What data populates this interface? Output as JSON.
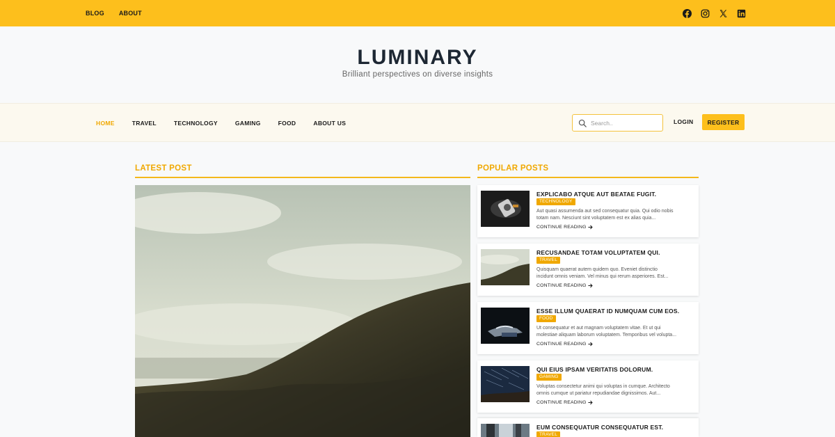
{
  "topbar": {
    "links": [
      "BLOG",
      "ABOUT"
    ],
    "social_icons": [
      "facebook-icon",
      "instagram-icon",
      "x-icon",
      "linkedin-icon"
    ],
    "background": "#fdbf1c"
  },
  "brand": {
    "title": "LUMINARY",
    "tagline": "Brilliant perspectives on diverse insights"
  },
  "nav": {
    "items": [
      {
        "label": "HOME",
        "active": true
      },
      {
        "label": "TRAVEL",
        "active": false
      },
      {
        "label": "TECHNOLOGY",
        "active": false
      },
      {
        "label": "GAMING",
        "active": false
      },
      {
        "label": "FOOD",
        "active": false
      },
      {
        "label": "ABOUT US",
        "active": false
      }
    ],
    "search_placeholder": "Search..",
    "login_label": "LOGIN",
    "register_label": "REGISTER"
  },
  "latest": {
    "heading": "LATEST POST"
  },
  "popular": {
    "heading": "POPULAR POSTS",
    "posts": [
      {
        "title": "EXPLICABO ATQUE AUT BEATAE FUGIT.",
        "category": "TECHNOLOGY",
        "excerpt_line1": "Aut quasi assumenda aut sed consequatur quia. Qui odio nobis",
        "excerpt_line2": "totam nam. Nesciunt sint voluptatem est ex alias quia...",
        "more": "CONTINUE READING"
      },
      {
        "title": "RECUSANDAE TOTAM VOLUPTATEM QUI.",
        "category": "TRAVEL",
        "excerpt_line1": "Quisquam quaerat autem quidem quo. Eveniet distinctio",
        "excerpt_line2": "incidunt omnis veniam. Vel minus qui rerum asperiores. Est...",
        "more": "CONTINUE READING"
      },
      {
        "title": "ESSE ILLUM QUAERAT ID NUMQUAM CUM EOS.",
        "category": "FOOD",
        "excerpt_line1": "Ut consequatur et aut magnam voluptatem vitae. Et ut qui",
        "excerpt_line2": "molestiae aliquam laborum voluptatem. Temporibus vel volupta...",
        "more": "CONTINUE READING"
      },
      {
        "title": "QUI EIUS IPSAM VERITATIS DOLORUM.",
        "category": "GAMING",
        "excerpt_line1": "Voluptas consectetur animi qui voluptas in cumque. Architecto",
        "excerpt_line2": "omnis cumque ut pariatur repudiandae dignissimos. Aut...",
        "more": "CONTINUE READING"
      },
      {
        "title": "EUM CONSEQUATUR CONSEQUATUR EST.",
        "category": "TRAVEL",
        "excerpt_line1": "",
        "excerpt_line2": "",
        "more": ""
      }
    ]
  },
  "colors": {
    "accent": "#fdbf1c",
    "accent_text": "#f0a800",
    "title": "#1d2733"
  }
}
